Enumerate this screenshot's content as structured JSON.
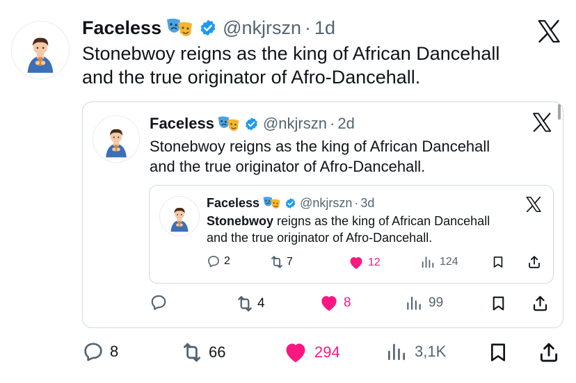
{
  "tweet": {
    "name": "Faceless",
    "handle": "@nkjrszn",
    "time": "1d",
    "line1": "Stonebwoy reigns as the king of African Dancehall",
    "line2": "and the true originator of Afro-Dancehall.",
    "replies": "8",
    "reposts": "66",
    "likes": "294",
    "views": "3,1K"
  },
  "quote1": {
    "name": "Faceless",
    "handle": "@nkjrszn",
    "time": "2d",
    "line1": "Stonebwoy reigns as the king of African Dancehall",
    "line2": "and the true originator of Afro-Dancehall.",
    "replies": "",
    "reposts": "4",
    "likes": "8",
    "views": "99"
  },
  "quote2": {
    "name": "Faceless",
    "handle": "@nkjrszn",
    "time": "3d",
    "line1_bold": "Stonebwoy",
    "line1_rest": " reigns as the king of African Dancehall",
    "line2": "and the true originator of Afro-Dancehall.",
    "replies": "2",
    "reposts": "7",
    "likes": "12",
    "views": "124"
  },
  "icons": {
    "masks": "theater-masks-emoji",
    "verified": "verified-badge-icon",
    "brand": "x-logo-icon",
    "reply": "reply-icon",
    "repost": "repost-icon",
    "like": "heart-icon",
    "views": "views-icon",
    "bookmark": "bookmark-icon",
    "share": "share-icon"
  },
  "colors": {
    "verified": "#1d9bf0",
    "like": "#f91880",
    "muted": "#536471",
    "border": "#cfd9de"
  }
}
